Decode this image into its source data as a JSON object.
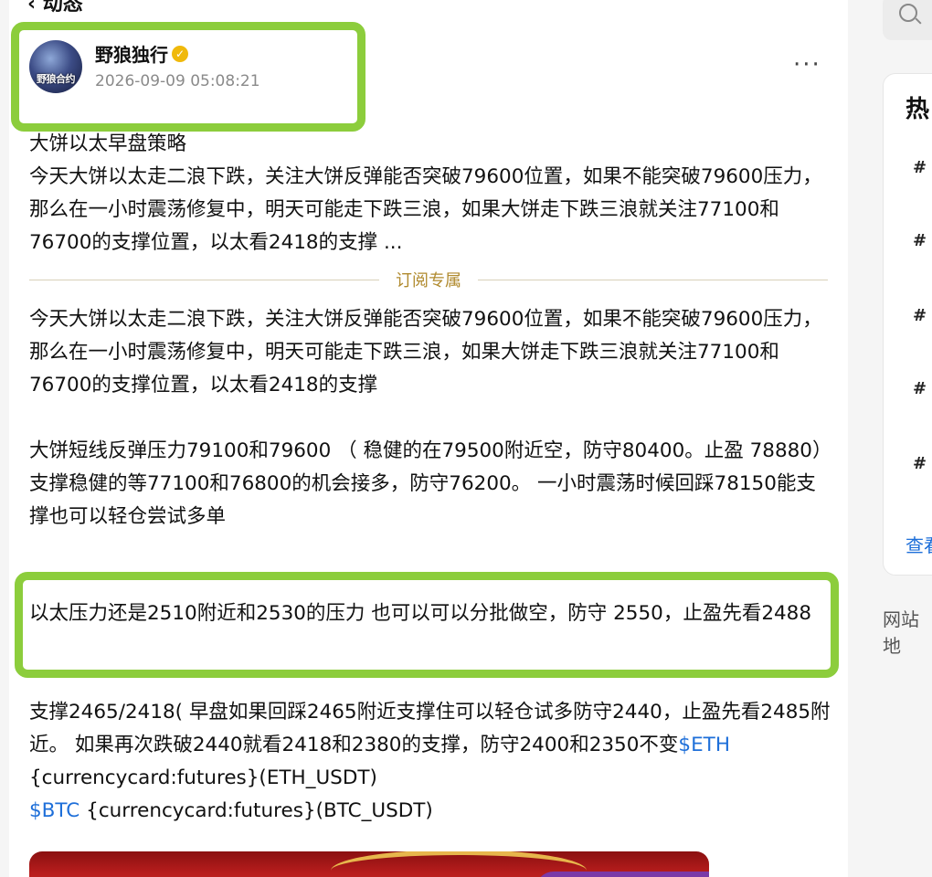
{
  "header": {
    "back_title_partial": "‹ 动态"
  },
  "author": {
    "name": "野狼独行",
    "avatar_text": "野狼合约",
    "timestamp": "2026-09-09 05:08:21",
    "verified_color": "#f0b90b",
    "more_label": "···"
  },
  "post": {
    "summary_lines": [
      "大饼以太早盘策略",
      "今天大饼以太走二浪下跌，关注大饼反弹能否突破79600位置，如果不能突破79600压力，那么在一小时震荡修复中，明天可能走下跌三浪，如果大饼走下跌三浪就关注77100和76700的支撑位置，以太看2418的支撑 ..."
    ],
    "divider_label": "订阅专属",
    "full_para_1": "今天大饼以太走二浪下跌，关注大饼反弹能否突破79600位置，如果不能突破79600压力，那么在一小时震荡修复中，明天可能走下跌三浪，如果大饼走下跌三浪就关注77100和76700的支撑位置，以太看2418的支撑",
    "full_para_2a": "大饼短线反弹压力79100和79600 （ 稳健的在79500附近空，防守80400。止盈 78880）",
    "full_para_2b": "支撑稳健的等77100和76800的机会接多，防守76200。   一小时震荡时候回踩78150能支撑也可以轻仓尝试多单",
    "full_para_3": "以太压力还是2510附近和2530的压力 也可以可以分批做空，防守 2550，止盈先看2488",
    "full_para_4": "支撑2465/2418( 早盘如果回踩2465附近支撑住可以轻仓试多防守2440，止盈先看2485附近。 如果再次跌破2440就看2418和2380的支撑，防守2400和2350不变",
    "tag_eth": "$ETH",
    "card_eth": " {currencycard:futures}(ETH_USDT)",
    "tag_btc": "$BTC",
    "card_btc": " {currencycard:futures}(BTC_USDT)"
  },
  "sidebar": {
    "hot_title": "热",
    "hash_symbol": "#",
    "view_more": "查看",
    "site_label": "网站地"
  },
  "colors": {
    "highlight": "#8ccd3c",
    "link": "#1e6fd9",
    "divider_text": "#b08a2e"
  }
}
